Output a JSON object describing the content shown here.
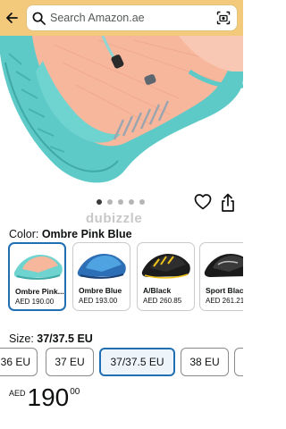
{
  "search": {
    "placeholder": "Search Amazon.ae"
  },
  "watermark": "dubizzle",
  "gallery": {
    "dot_count": 5,
    "active_index": 0
  },
  "color": {
    "label": "Color:",
    "selected": "Ombre Pink Blue",
    "options": [
      {
        "name": "Ombre Pink...",
        "price": "AED 190.00",
        "selected": true
      },
      {
        "name": "Ombre Blue",
        "price": "AED 193.00",
        "selected": false
      },
      {
        "name": "A/Black",
        "price": "AED 260.85",
        "selected": false
      },
      {
        "name": "Sport Black",
        "price": "AED 261.21",
        "selected": false
      }
    ]
  },
  "size": {
    "label": "Size:",
    "selected": "37/37.5 EU",
    "options": [
      "36 EU",
      "37 EU",
      "37/37.5 EU",
      "38 EU"
    ]
  },
  "price": {
    "currency": "AED",
    "whole": "190",
    "fraction": "00"
  },
  "colors": {
    "header": "#f3c97c",
    "accent": "#1f6fb2",
    "shoe_sole": "#5dcac7",
    "shoe_upper": "#f6b79c"
  },
  "icons": [
    "back-arrow-icon",
    "search-icon",
    "camera-search-icon",
    "heart-icon",
    "share-icon"
  ]
}
